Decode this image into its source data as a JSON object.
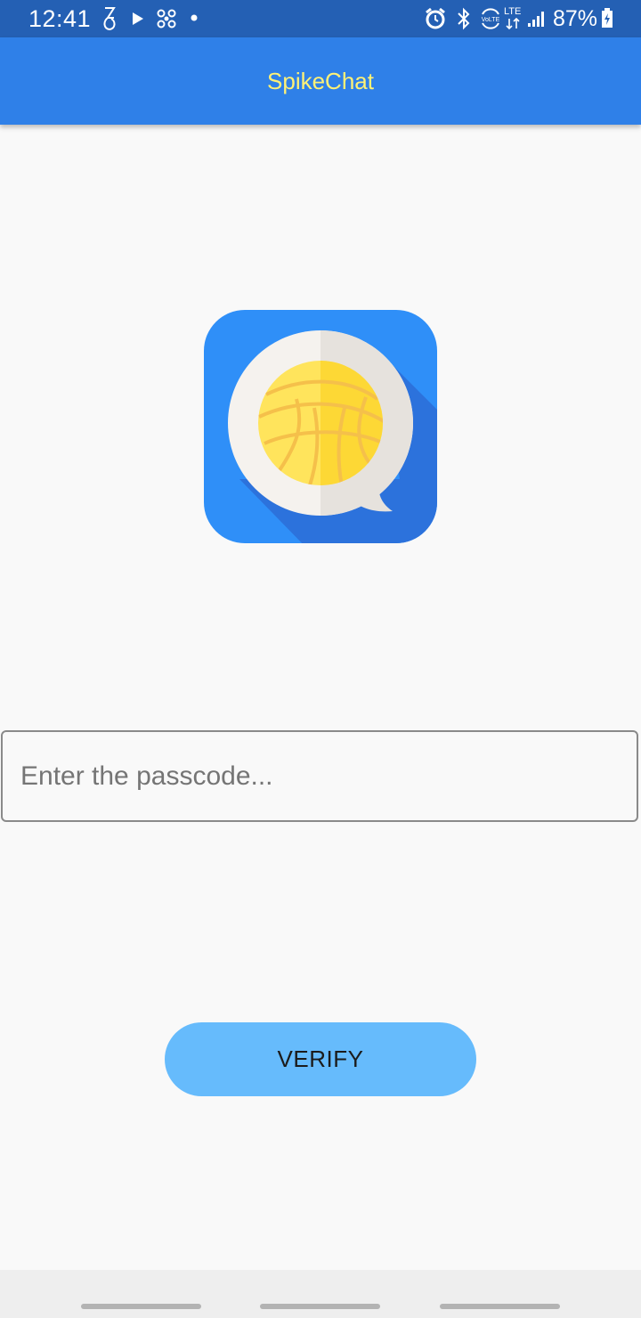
{
  "status_bar": {
    "time": "12:41",
    "battery_percent": "87%",
    "network_label": "LTE",
    "left_icons": [
      "ring-icon",
      "play-icon",
      "fan-icon",
      "dot-icon"
    ],
    "right_icons": [
      "alarm-icon",
      "bluetooth-icon",
      "volte-icon",
      "lte-icon",
      "signal-icon",
      "battery-charging-icon"
    ]
  },
  "app_bar": {
    "title": "SpikeChat",
    "title_color": "#fff176",
    "background_color": "#2f80e8"
  },
  "logo": {
    "icon": "volleyball-chat-bubble-logo",
    "background_color": "#2f8ff8",
    "ball_color": "#fdd835"
  },
  "passcode": {
    "placeholder": "Enter the passcode...",
    "value": ""
  },
  "verify_button": {
    "label": "VERIFY",
    "color": "#66bbfc"
  },
  "nav_bar": {
    "handles": 3
  }
}
